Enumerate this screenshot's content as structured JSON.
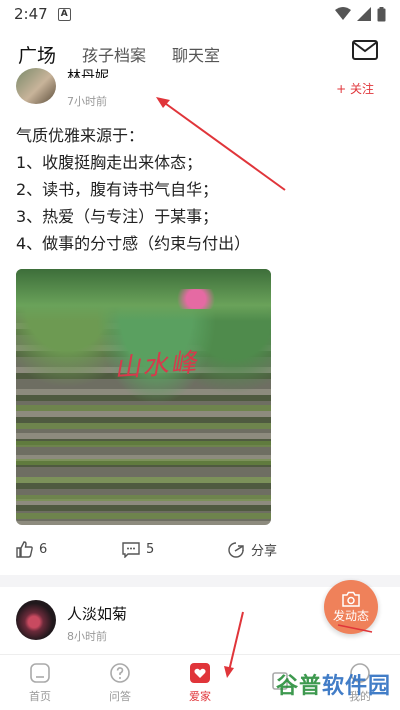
{
  "status_bar": {
    "time": "2:47",
    "a_badge": "A"
  },
  "tabs": [
    {
      "label": "广场"
    },
    {
      "label": "孩子档案"
    },
    {
      "label": "聊天室"
    }
  ],
  "post1": {
    "username": "林丹妮",
    "time": "7小时前",
    "follow_label": "+ 关注",
    "lines": [
      "气质优雅来源于：",
      "1、收腹挺胸走出来体态；",
      "2、读书，腹有诗书气自华；",
      "3、热爱（与专注）于某事；",
      "4、做事的分寸感（约束与付出）"
    ],
    "photo_text": "山水峰",
    "likes": "6",
    "comments": "5",
    "share_label": "分享"
  },
  "post2": {
    "username": "人淡如菊",
    "time": "8小时前"
  },
  "fab_label": "发动态",
  "bottom_nav": [
    {
      "label": "首页",
      "icon": "home-icon"
    },
    {
      "label": "问答",
      "icon": "question-icon"
    },
    {
      "label": "爱家",
      "icon": "heart-icon"
    },
    {
      "label": "",
      "icon": "store-icon"
    },
    {
      "label": "我的",
      "icon": "profile-icon"
    }
  ],
  "watermark": {
    "part1": "谷普",
    "part2": "软件园"
  },
  "colors": {
    "accent": "#e0353a",
    "fab": "#ef7b52",
    "annotation_arrow": "#e0353a"
  }
}
